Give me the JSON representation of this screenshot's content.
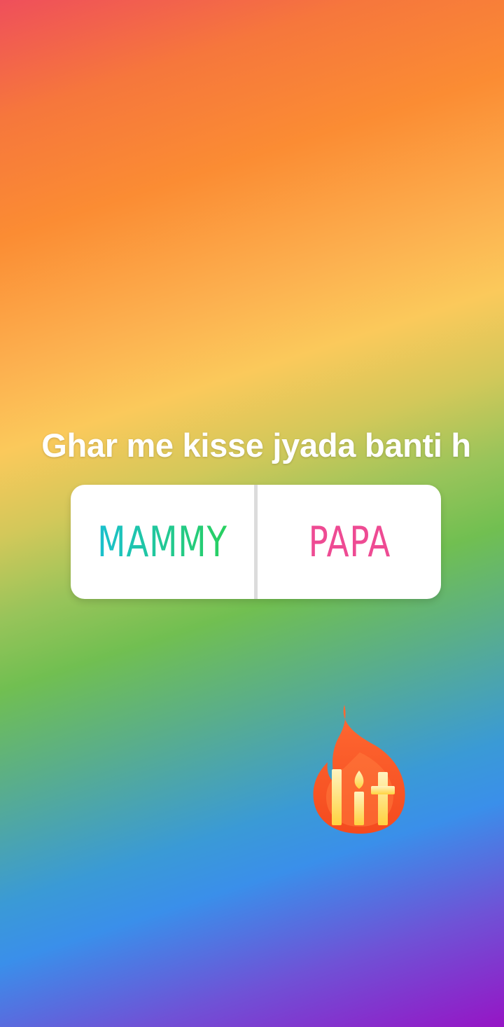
{
  "story": {
    "question": "Ghar me kisse jyada banti h",
    "poll": {
      "options": [
        "MAMMY",
        "PAPA"
      ]
    },
    "sticker": {
      "icon": "lit-fire-sticker-icon",
      "text": "lit"
    },
    "colors": {
      "option_left_gradient": [
        "#1ac0cf",
        "#29d05e"
      ],
      "option_right": "#ee4b93",
      "flame_outer": "#ff5a2e",
      "flame_inner": "#ffd84d"
    }
  }
}
